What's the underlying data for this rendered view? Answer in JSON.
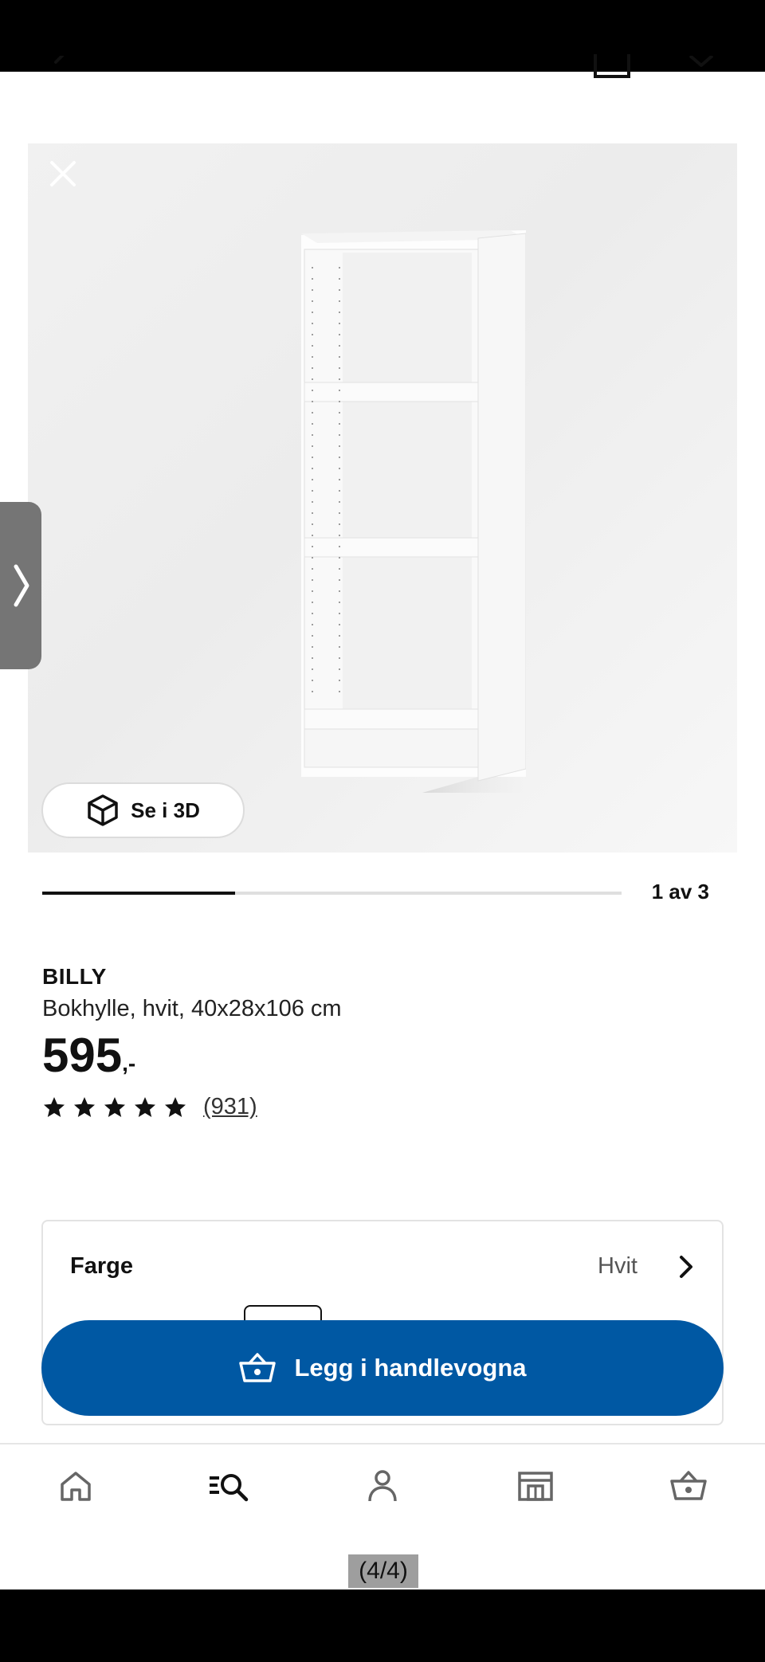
{
  "header": {
    "icons": [
      "back-arrow-icon",
      "package-icon",
      "heart-icon"
    ]
  },
  "gallery": {
    "close_icon": "close-icon",
    "view_3d_label": "Se i 3D",
    "view_3d_icon": "cube-icon",
    "side_handle_icon": "chevron-right-icon",
    "progress": {
      "current": 1,
      "total": 3,
      "fraction": 0.3333,
      "label": "1 av 3"
    }
  },
  "product": {
    "name": "BILLY",
    "description": "Bokhylle, hvit, 40x28x106 cm",
    "price": "595",
    "price_suffix": ",-",
    "rating_stars": 5,
    "reviews": "(931)"
  },
  "color": {
    "label": "Farge",
    "value": "Hvit"
  },
  "cart_button": {
    "label": "Legg i handlevogna",
    "icon": "basket-icon"
  },
  "bottom_nav": {
    "items": [
      {
        "name": "home",
        "icon": "home-icon"
      },
      {
        "name": "search",
        "icon": "search-icon"
      },
      {
        "name": "profile",
        "icon": "person-icon"
      },
      {
        "name": "store",
        "icon": "store-icon"
      },
      {
        "name": "cart",
        "icon": "basket-icon"
      }
    ]
  },
  "screenshot_counter": "(4/4)",
  "colors": {
    "accent": "#0058a3",
    "text": "#111111",
    "muted": "#555555"
  }
}
